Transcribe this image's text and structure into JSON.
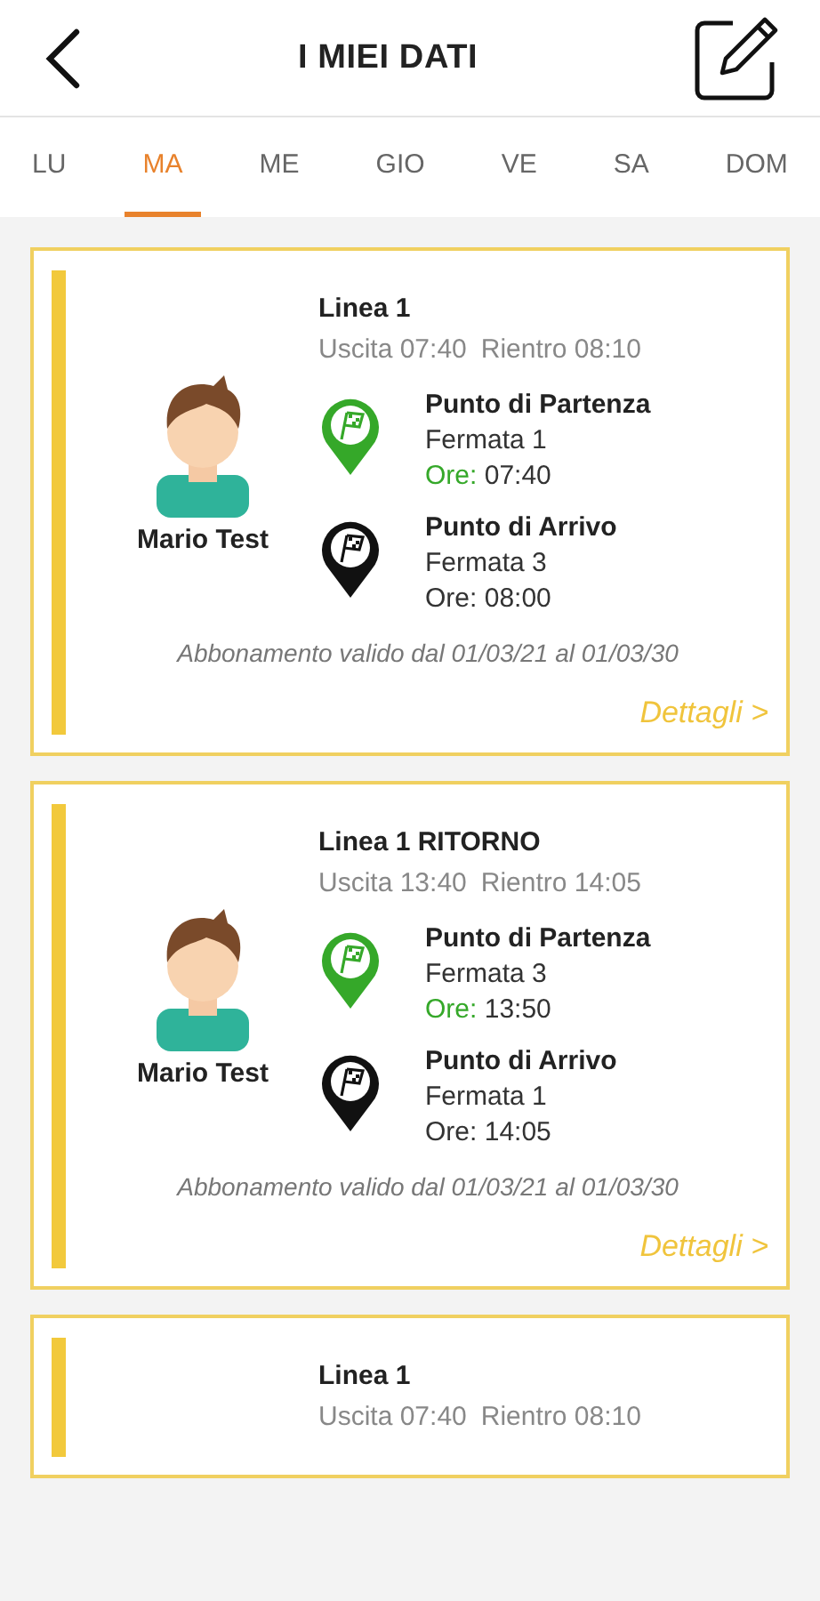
{
  "header": {
    "title": "I MIEI DATI"
  },
  "tabs": [
    {
      "label": "LU",
      "selected": false
    },
    {
      "label": "MA",
      "selected": true
    },
    {
      "label": "ME",
      "selected": false
    },
    {
      "label": "GIO",
      "selected": false
    },
    {
      "label": "VE",
      "selected": false
    },
    {
      "label": "SA",
      "selected": false
    },
    {
      "label": "DOM",
      "selected": false
    }
  ],
  "cards": [
    {
      "name": "Mario Test",
      "line": "Linea 1",
      "exit": "Uscita 07:40",
      "return": "Rientro 08:10",
      "stops": [
        {
          "kind": "start",
          "title": "Punto di Partenza",
          "stop": "Fermata 1",
          "time_label": "Ore:",
          "time": "07:40"
        },
        {
          "kind": "end",
          "title": "Punto di Arrivo",
          "stop": "Fermata 3",
          "time_label": "Ore:",
          "time": "08:00"
        }
      ],
      "validity": "Abbonamento valido dal 01/03/21 al 01/03/30",
      "details": "Dettagli >"
    },
    {
      "name": "Mario Test",
      "line": "Linea 1 RITORNO",
      "exit": "Uscita 13:40",
      "return": "Rientro 14:05",
      "stops": [
        {
          "kind": "start",
          "title": "Punto di Partenza",
          "stop": "Fermata 3",
          "time_label": "Ore:",
          "time": "13:50"
        },
        {
          "kind": "end",
          "title": "Punto di Arrivo",
          "stop": "Fermata 1",
          "time_label": "Ore:",
          "time": "14:05"
        }
      ],
      "validity": "Abbonamento valido dal 01/03/21 al 01/03/30",
      "details": "Dettagli >"
    },
    {
      "line": "Linea 1",
      "exit": "Uscita 07:40",
      "return": "Rientro 08:10"
    }
  ]
}
